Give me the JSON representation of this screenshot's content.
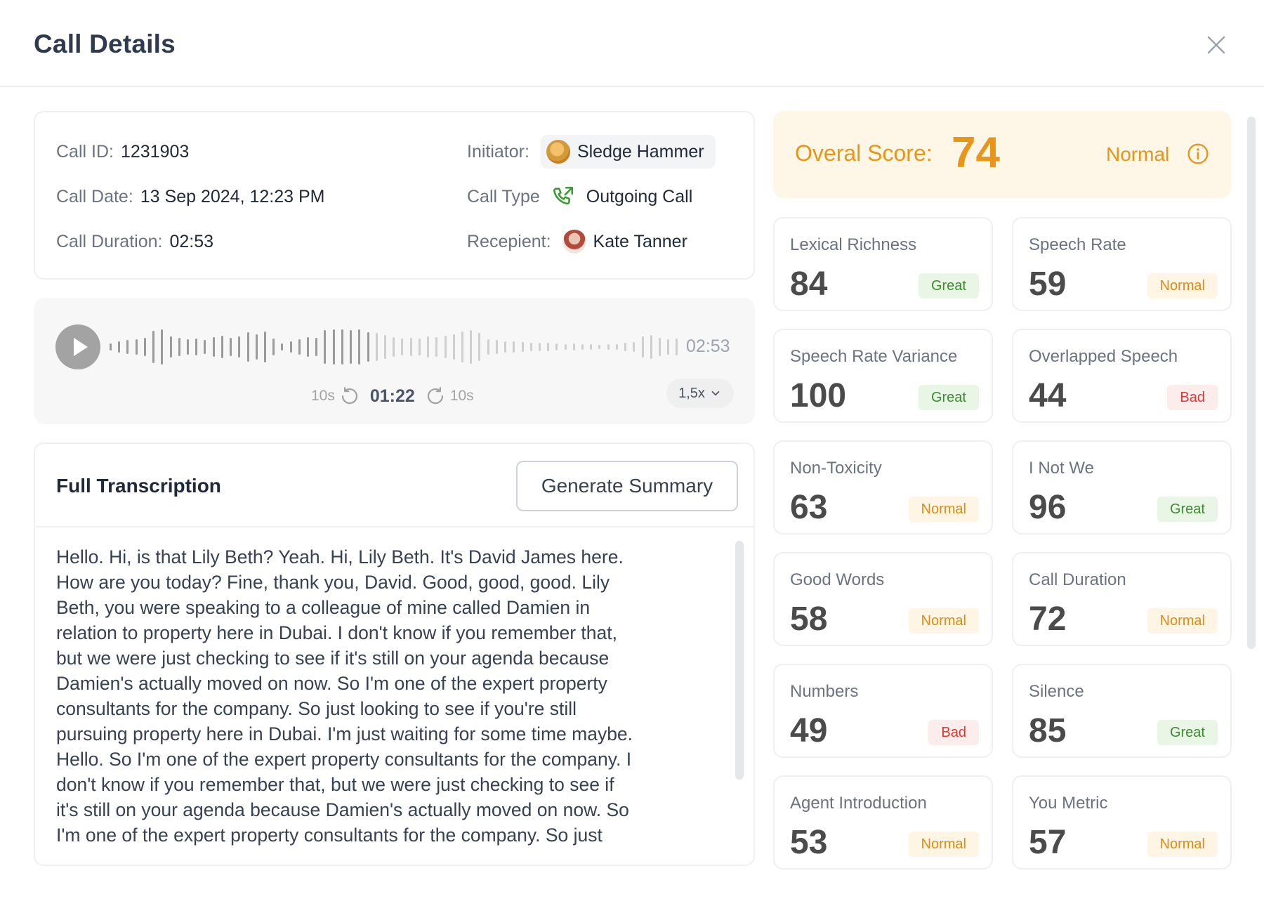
{
  "header": {
    "title": "Call Details"
  },
  "call_info": {
    "id_label": "Call ID:",
    "id_value": "1231903",
    "date_label": "Call Date:",
    "date_value": "13 Sep 2024, 12:23 PM",
    "duration_label": "Call Duration:",
    "duration_value": "02:53",
    "initiator_label": "Initiator:",
    "initiator_name": "Sledge Hammer",
    "type_label": "Call Type",
    "type_value": "Outgoing Call",
    "recipient_label": "Recepient:",
    "recipient_name": "Kate Tanner"
  },
  "player": {
    "total_time": "02:53",
    "current_time": "01:22",
    "skip_back": "10s",
    "skip_forward": "10s",
    "speed": "1,5x",
    "progress": 0.47,
    "colors": {
      "played": "#9a9a9a",
      "unplayed": "#cfcfcf"
    }
  },
  "transcription": {
    "title": "Full Transcription",
    "button": "Generate Summary",
    "lines": [
      "Hello. Hi, is that Lily Beth? Yeah. Hi, Lily Beth. It's David James here.",
      "How are you today? Fine, thank you, David. Good, good, good. Lily",
      "Beth, you were speaking to a colleague of mine called Damien in",
      "relation to property here in Dubai. I don't know if you remember that,",
      "but we were just checking to see if it's still on your agenda because",
      "Damien's actually moved on now. So I'm one of the expert property",
      "consultants for the company. So just looking to see if you're still",
      "pursuing property here in Dubai. I'm just waiting for some time maybe.",
      "Hello. So I'm one of the expert property consultants for the company.  I",
      "don't know if you remember that, but we were just checking to see if",
      "it's still on your agenda because Damien's actually moved on now. So",
      "I'm one of the expert property consultants for the company. So just"
    ]
  },
  "overall": {
    "label": "Overal Score:",
    "score": "74",
    "status": "Normal",
    "color": "#e89519"
  },
  "metrics": [
    {
      "name": "Lexical Richness",
      "value": "84",
      "status": "Great"
    },
    {
      "name": "Speech Rate",
      "value": "59",
      "status": "Normal"
    },
    {
      "name": "Speech Rate Variance",
      "value": "100",
      "status": "Great"
    },
    {
      "name": "Overlapped Speech",
      "value": "44",
      "status": "Bad"
    },
    {
      "name": "Non-Toxicity",
      "value": "63",
      "status": "Normal"
    },
    {
      "name": "I Not We",
      "value": "96",
      "status": "Great"
    },
    {
      "name": "Good Words",
      "value": "58",
      "status": "Normal"
    },
    {
      "name": "Call Duration",
      "value": "72",
      "status": "Normal"
    },
    {
      "name": "Numbers",
      "value": "49",
      "status": "Bad"
    },
    {
      "name": "Silence",
      "value": "85",
      "status": "Great"
    },
    {
      "name": "Agent Introduction",
      "value": "53",
      "status": "Normal"
    },
    {
      "name": "You Metric",
      "value": "57",
      "status": "Normal"
    }
  ]
}
